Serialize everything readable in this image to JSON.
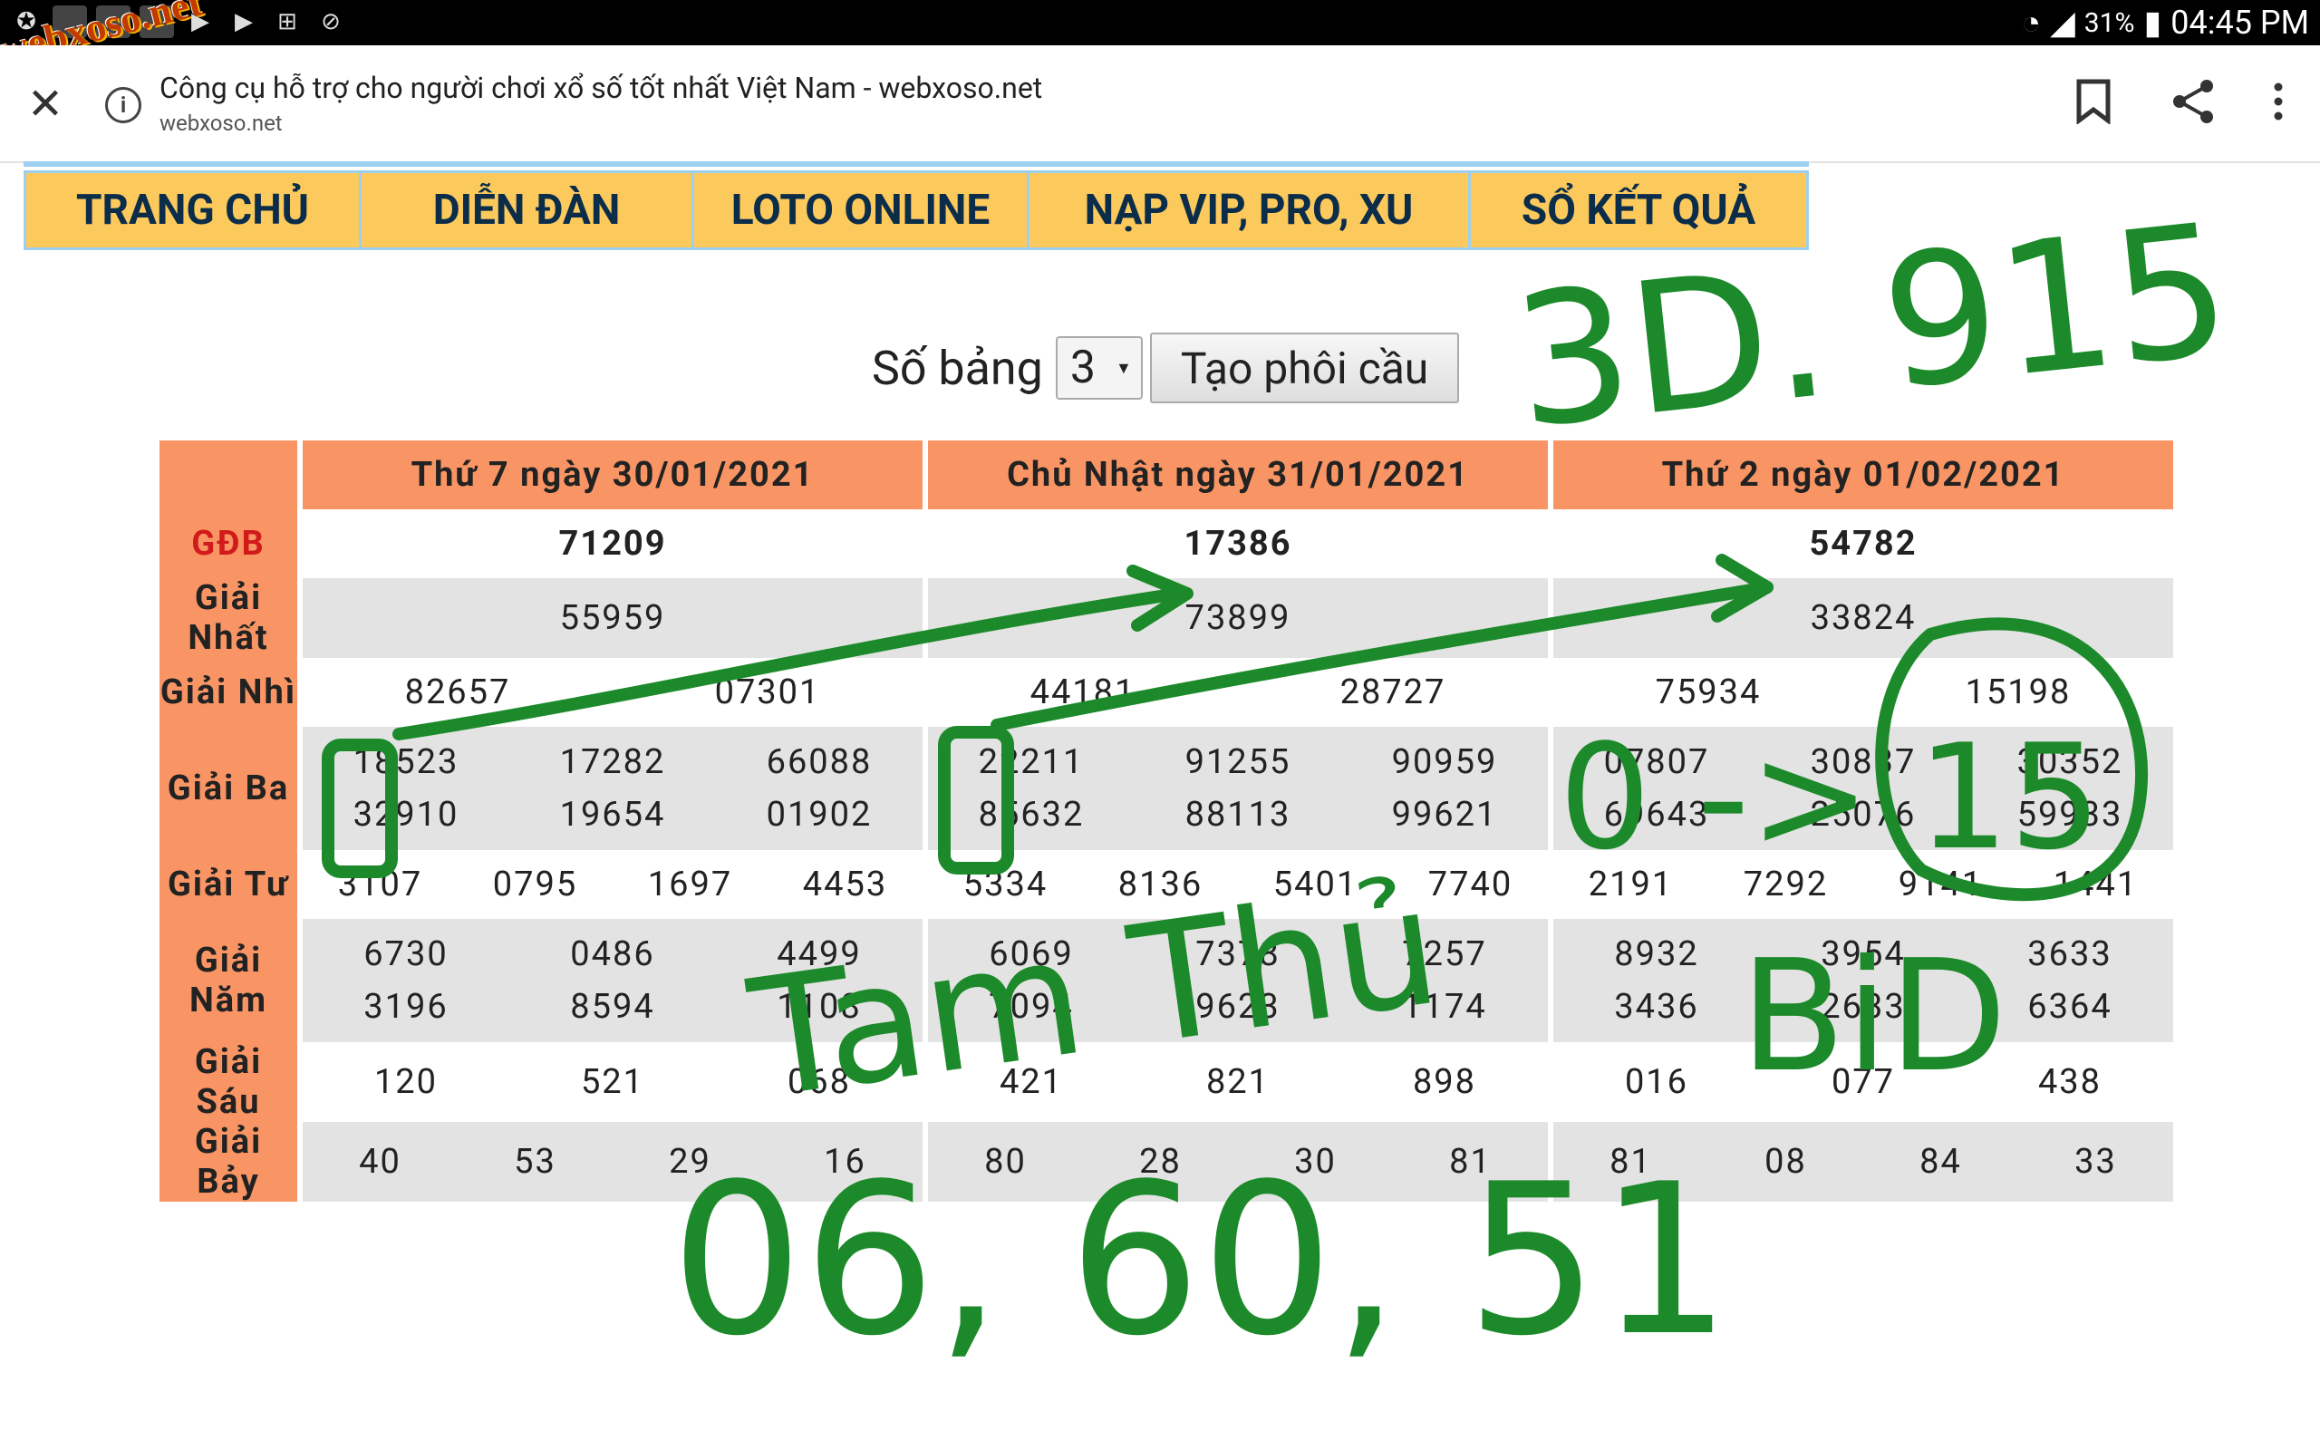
{
  "status_bar": {
    "battery": "31%",
    "time": "04:45 PM"
  },
  "logo_text": "webxoso.net",
  "browser": {
    "page_title": "Công cụ hỗ trợ cho người chơi xổ số tốt nhất Việt Nam - webxoso.net",
    "url": "webxoso.net"
  },
  "nav": [
    "TRANG CHỦ",
    "DIỄN ĐÀN",
    "LOTO ONLINE",
    "NẠP VIP, PRO, XU",
    "SỔ KẾT QUẢ"
  ],
  "controls": {
    "label": "Số bảng",
    "select_value": "3",
    "button": "Tạo phôi cầu"
  },
  "columns": [
    "Thứ 7 ngày 30/01/2021",
    "Chủ Nhật ngày 31/01/2021",
    "Thứ 2 ngày 01/02/2021"
  ],
  "labels": [
    "GĐB",
    "Giải Nhất",
    "Giải Nhì",
    "Giải Ba",
    "Giải Tư",
    "Giải Năm",
    "Giải Sáu",
    "Giải Bảy"
  ],
  "results": [
    {
      "gdb": "71209",
      "nhat": "55959",
      "nhi": [
        "82657",
        "07301"
      ],
      "ba": [
        "18523",
        "17282",
        "66088",
        "32910",
        "19654",
        "01902"
      ],
      "tu": [
        "3107",
        "0795",
        "1697",
        "4453"
      ],
      "nam": [
        "6730",
        "0486",
        "4499",
        "3196",
        "8594",
        "1108"
      ],
      "sau": [
        "120",
        "521",
        "068"
      ],
      "bay": [
        "40",
        "53",
        "29",
        "16"
      ]
    },
    {
      "gdb": "17386",
      "nhat": "73899",
      "nhi": [
        "44181",
        "28727"
      ],
      "ba": [
        "22211",
        "91255",
        "90959",
        "85632",
        "88113",
        "99621"
      ],
      "tu": [
        "5334",
        "8136",
        "5401",
        "7740"
      ],
      "nam": [
        "6069",
        "7378",
        "7257",
        "7094",
        "9623",
        "1174"
      ],
      "sau": [
        "421",
        "821",
        "898"
      ],
      "bay": [
        "80",
        "28",
        "30",
        "81"
      ]
    },
    {
      "gdb": "54782",
      "nhat": "33824",
      "nhi": [
        "75934",
        "15198"
      ],
      "ba": [
        "07807",
        "30837",
        "30352",
        "69643",
        "25076",
        "59933"
      ],
      "tu": [
        "2191",
        "7292",
        "9141",
        "1441"
      ],
      "nam": [
        "8932",
        "3954",
        "3633",
        "3436",
        "2633",
        "6364"
      ],
      "sau": [
        "016",
        "077",
        "438"
      ],
      "bay": [
        "81",
        "08",
        "84",
        "33"
      ]
    }
  ],
  "annotations": {
    "top": "3D. 915",
    "arrow_note": "0 -> 15",
    "mid_a": "Tam Thủ",
    "mid_b": "BiD",
    "bottom": "06, 60, 51"
  }
}
